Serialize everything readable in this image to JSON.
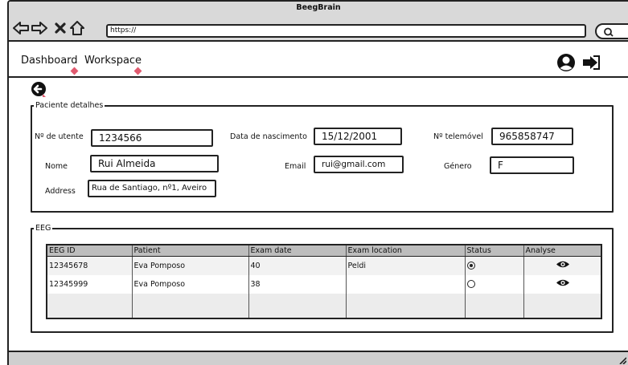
{
  "window": {
    "title": "BeegBrain"
  },
  "browser": {
    "url": "https://",
    "icons": [
      "back-arrow-icon",
      "forward-arrow-icon",
      "close-x-icon",
      "home-icon",
      "search-icon"
    ]
  },
  "nav": {
    "dashboard": "Dashboard",
    "workspace": "Workspace",
    "icons": [
      "user-icon",
      "logout-icon"
    ]
  },
  "patient": {
    "legend": "Paciente detalhes",
    "utente_label": "Nº de utente",
    "utente_value": "1234566",
    "birth_label": "Data de nascimento",
    "birth_value": "15/12/2001",
    "phone_label": "Nº telemóvel",
    "phone_value": "965858747",
    "name_label": "Nome",
    "name_value": "Rui Almeida",
    "email_label": "Email",
    "email_value": "rui@gmail.com",
    "gender_label": "Género",
    "gender_value": "F",
    "address_label": "Address",
    "address_value": "Rua de Santiago, nº1, Aveiro"
  },
  "eeg": {
    "legend": "EEG",
    "headers": [
      "EEG ID",
      "Patient",
      "Exam date",
      "Exam location",
      "Status",
      "Analyse"
    ],
    "rows": [
      {
        "id": "12345678",
        "patient": "Eva Pomposo",
        "date": "40",
        "location": "Peldi",
        "status_selected": true,
        "analyse_icon": "eye-icon"
      },
      {
        "id": "12345999",
        "patient": "Eva Pomposo",
        "date": "38",
        "location": "",
        "status_selected": false,
        "analyse_icon": "eye-icon"
      }
    ]
  },
  "colors": {
    "chrome": "#d9d9d9",
    "table_header": "#bdbdbd",
    "cursor_marker": "#e05a6f"
  }
}
